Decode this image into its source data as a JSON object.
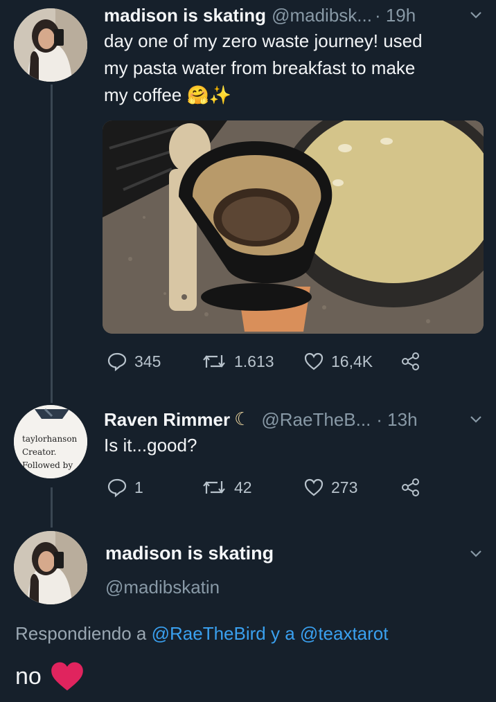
{
  "tweet1": {
    "name": "madison is skating",
    "handle": "@madibsk...",
    "time": "· 19h",
    "text_line1": "day one of my zero waste journey! used",
    "text_line2": "my pasta water from breakfast to make",
    "text_line3": "my coffee",
    "emoji": "🤗✨",
    "replies": "345",
    "retweets": "1.613",
    "likes": "16,4K"
  },
  "tweet2": {
    "name": "Raven Rimmer",
    "moon": "☾",
    "handle": "@RaeTheB...",
    "time": "· 13h",
    "text": "Is it...good?",
    "replies": "1",
    "retweets": "42",
    "likes": "273",
    "avatar_lines": [
      "taylorhanson",
      "Creator.",
      "Followed by"
    ]
  },
  "tweet3": {
    "name": "madison is skating",
    "handle": "@madibskatin",
    "replying_prefix": "Respondiendo a",
    "replying_user1": "@RaeTheBird",
    "replying_and": "y a",
    "replying_user2": "@teaxtarot",
    "text": "no"
  },
  "colors": {
    "background": "#16202b",
    "link": "#3aa0ef",
    "heart": "#e0245e"
  }
}
